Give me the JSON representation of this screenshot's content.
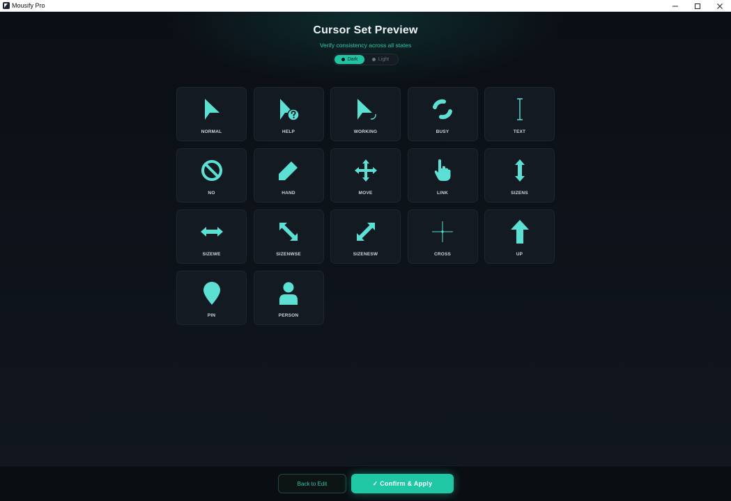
{
  "window": {
    "title": "Mousify Pro"
  },
  "header": {
    "title": "Cursor Set Preview",
    "subtitle": "Verify consistency across all states"
  },
  "theme_toggle": {
    "options": [
      {
        "label": "Dark",
        "active": true
      },
      {
        "label": "Light",
        "active": false
      }
    ]
  },
  "colors": {
    "accent": "#1fc4a3",
    "icon": "#5ce0d4",
    "background": "#0d1117",
    "card": "#141a22"
  },
  "cursors": [
    {
      "label": "NORMAL",
      "icon": "arrow-icon"
    },
    {
      "label": "HELP",
      "icon": "arrow-help-icon"
    },
    {
      "label": "WORKING",
      "icon": "arrow-working-icon"
    },
    {
      "label": "BUSY",
      "icon": "busy-spinner-icon"
    },
    {
      "label": "TEXT",
      "icon": "text-ibeam-icon"
    },
    {
      "label": "NO",
      "icon": "no-symbol-icon"
    },
    {
      "label": "HAND",
      "icon": "pencil-icon"
    },
    {
      "label": "MOVE",
      "icon": "move-icon"
    },
    {
      "label": "LINK",
      "icon": "hand-pointer-icon"
    },
    {
      "label": "SIZENS",
      "icon": "resize-vertical-icon"
    },
    {
      "label": "SIZEWE",
      "icon": "resize-horizontal-icon"
    },
    {
      "label": "SIZENWSE",
      "icon": "resize-nwse-icon"
    },
    {
      "label": "SIZENESW",
      "icon": "resize-nesw-icon"
    },
    {
      "label": "CROSS",
      "icon": "crosshair-icon"
    },
    {
      "label": "UP",
      "icon": "up-arrow-icon"
    },
    {
      "label": "PIN",
      "icon": "pin-icon"
    },
    {
      "label": "PERSON",
      "icon": "person-icon"
    }
  ],
  "footer": {
    "back_label": "Back to Edit",
    "confirm_label": "✓ Confirm & Apply"
  }
}
